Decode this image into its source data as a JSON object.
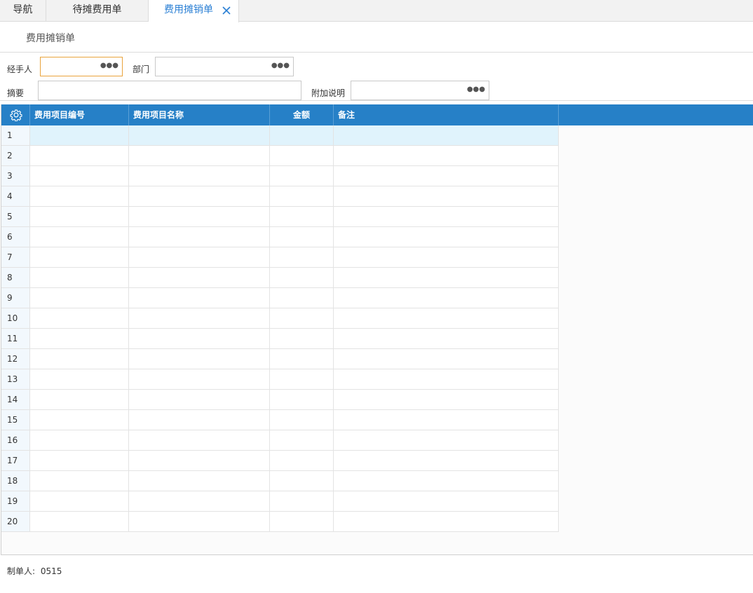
{
  "tabs": [
    {
      "label": "导航"
    },
    {
      "label": "待摊费用单"
    },
    {
      "label": "费用摊销单",
      "active": true
    }
  ],
  "page_title": "费用摊销单",
  "form": {
    "handler_label": "经手人",
    "handler_value": "",
    "dept_label": "部门",
    "dept_value": "",
    "summary_label": "摘要",
    "summary_value": "",
    "note_label": "附加说明",
    "note_value": ""
  },
  "grid": {
    "columns": [
      "费用项目编号",
      "费用项目名称",
      "金额",
      "备注"
    ],
    "rows": [
      "1",
      "2",
      "3",
      "4",
      "5",
      "6",
      "7",
      "8",
      "9",
      "10",
      "11",
      "12",
      "13",
      "14",
      "15",
      "16",
      "17",
      "18",
      "19",
      "20"
    ],
    "selected_row": 1
  },
  "footer": {
    "maker_label": "制单人:",
    "maker_value": "0515"
  },
  "colors": {
    "accent": "#2680c7",
    "active_tab_text": "#2a7fd4",
    "focus_border": "#e9a33c",
    "selected_row": "#e0f3fc"
  }
}
